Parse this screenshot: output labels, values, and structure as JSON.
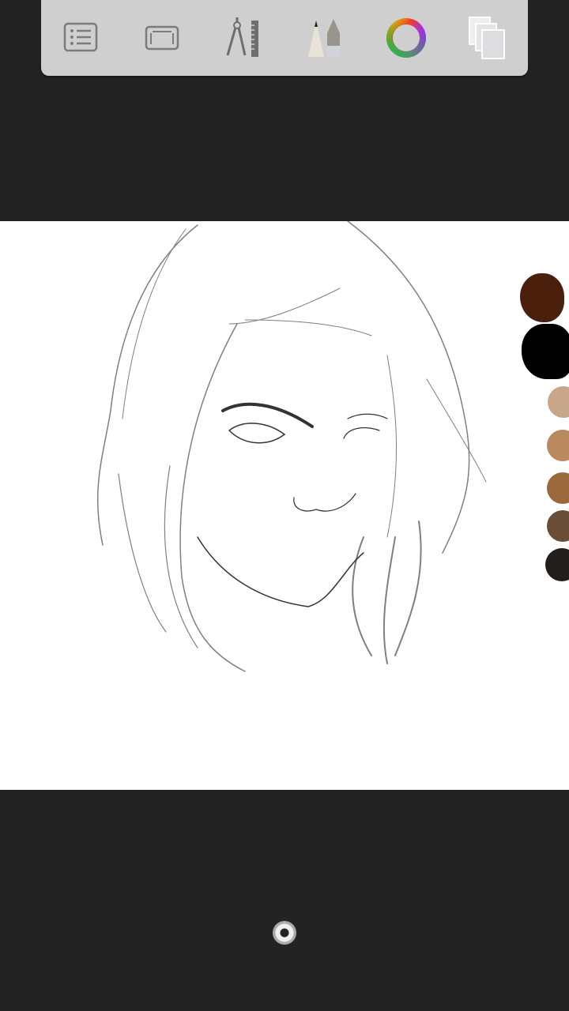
{
  "toolbar": {
    "tools": [
      {
        "icon": "list-icon",
        "name": "layers-menu"
      },
      {
        "icon": "frame-icon",
        "name": "fullscreen"
      },
      {
        "icon": "compass-ruler-icon",
        "name": "guides"
      },
      {
        "icon": "pencil-pen-icon",
        "name": "brushes"
      },
      {
        "icon": "color-wheel-icon",
        "name": "color"
      },
      {
        "icon": "layers-icon",
        "name": "layers"
      }
    ]
  },
  "palette": {
    "colors": [
      "#4a200c",
      "#000000",
      "#c8a68a",
      "#b88a5e",
      "#9a6a3c",
      "#6a4d36",
      "#221e1c"
    ]
  },
  "colors": {
    "background": "#232323",
    "toolbar": "#cfcfcf",
    "canvas": "#ffffff"
  }
}
